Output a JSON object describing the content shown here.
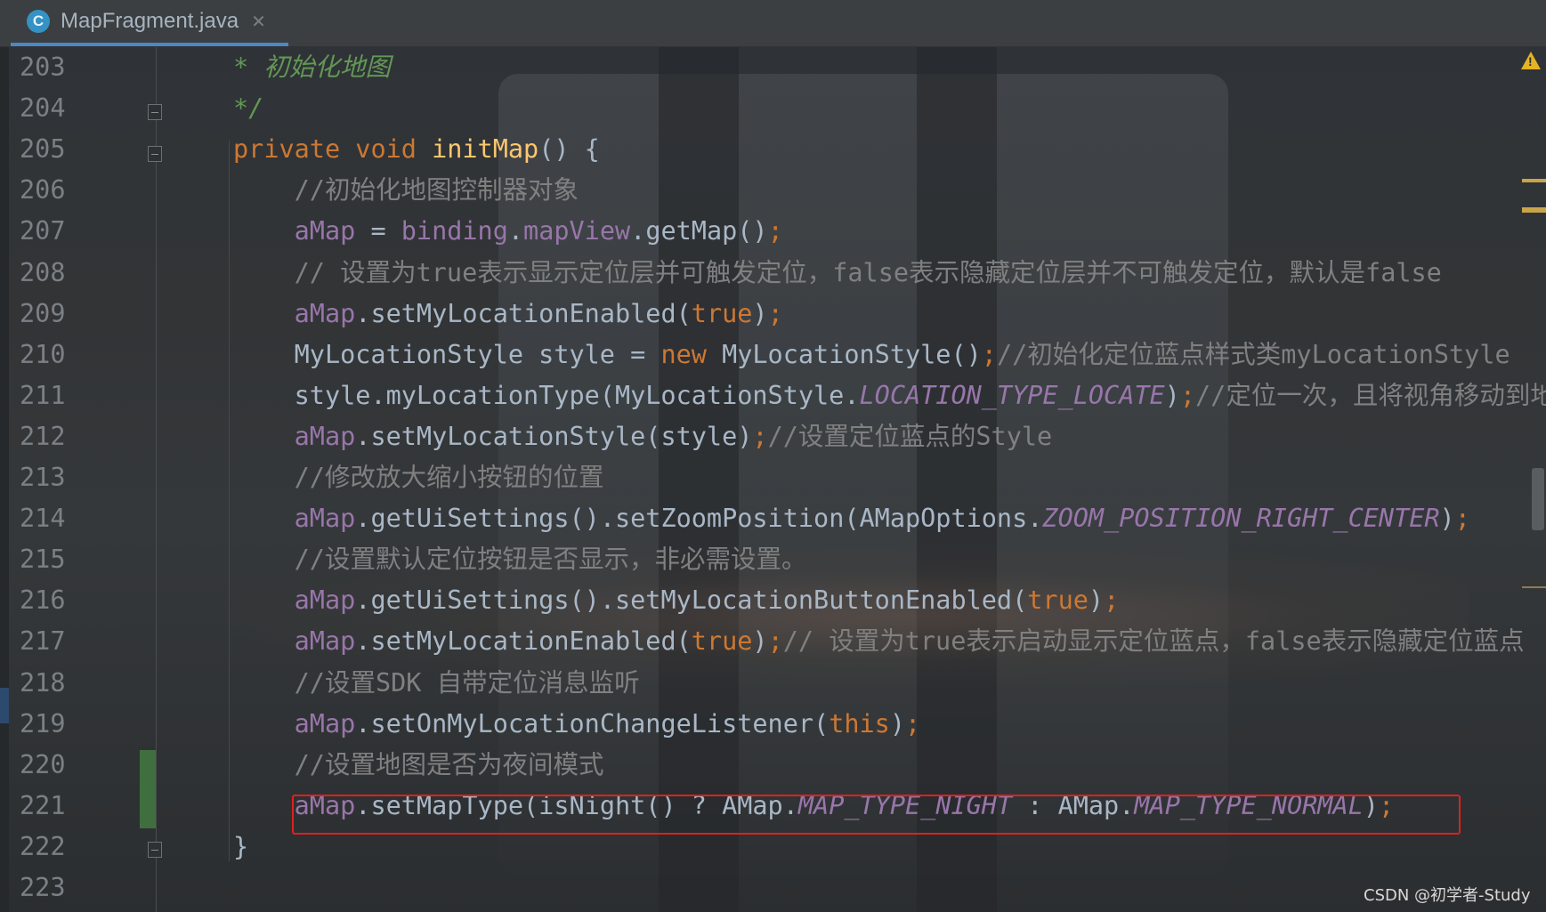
{
  "tab": {
    "icon_letter": "C",
    "filename": "MapFragment.java",
    "close_glyph": "✕"
  },
  "editor": {
    "lines": [
      {
        "num": "203",
        "code": [
          {
            "t": "* ",
            "c": "doc"
          },
          {
            "t": "初始化地图",
            "c": "doc"
          }
        ]
      },
      {
        "num": "204",
        "code": [
          {
            "t": "*/",
            "c": "doc"
          }
        ]
      },
      {
        "num": "205",
        "code": [
          {
            "t": "private ",
            "c": "kw"
          },
          {
            "t": "void ",
            "c": "kw"
          },
          {
            "t": "initMap",
            "c": "fn"
          },
          {
            "t": "() {",
            "c": "pl"
          }
        ]
      },
      {
        "num": "206",
        "code": [
          {
            "t": "    //初始化地图控制器对象",
            "c": "cmt"
          }
        ]
      },
      {
        "num": "207",
        "code": [
          {
            "t": "    ",
            "c": "pl"
          },
          {
            "t": "aMap",
            "c": "fld"
          },
          {
            "t": " = ",
            "c": "pl"
          },
          {
            "t": "binding",
            "c": "fld"
          },
          {
            "t": ".",
            "c": "pl"
          },
          {
            "t": "mapView",
            "c": "fld"
          },
          {
            "t": ".getMap()",
            "c": "pl"
          },
          {
            "t": ";",
            "c": "semi"
          }
        ]
      },
      {
        "num": "208",
        "code": [
          {
            "t": "    // 设置为true表示显示定位层并可触发定位，false表示隐藏定位层并不可触发定位，默认是false",
            "c": "cmt"
          }
        ]
      },
      {
        "num": "209",
        "code": [
          {
            "t": "    ",
            "c": "pl"
          },
          {
            "t": "aMap",
            "c": "fld"
          },
          {
            "t": ".setMyLocationEnabled(",
            "c": "pl"
          },
          {
            "t": "true",
            "c": "kw"
          },
          {
            "t": ")",
            "c": "pl"
          },
          {
            "t": ";",
            "c": "semi"
          }
        ]
      },
      {
        "num": "210",
        "code": [
          {
            "t": "    MyLocationStyle style = ",
            "c": "pl"
          },
          {
            "t": "new ",
            "c": "kw"
          },
          {
            "t": "MyLocationStyle()",
            "c": "pl"
          },
          {
            "t": ";",
            "c": "semi"
          },
          {
            "t": "//初始化定位蓝点样式类myLocationStyle",
            "c": "cmt"
          }
        ]
      },
      {
        "num": "211",
        "code": [
          {
            "t": "    style.myLocationType(MyLocationStyle.",
            "c": "pl"
          },
          {
            "t": "LOCATION_TYPE_LOCATE",
            "c": "fldi"
          },
          {
            "t": ")",
            "c": "pl"
          },
          {
            "t": ";",
            "c": "semi"
          },
          {
            "t": "//定位一次，且将视角移动到地图中心点",
            "c": "cmt"
          }
        ]
      },
      {
        "num": "212",
        "code": [
          {
            "t": "    ",
            "c": "pl"
          },
          {
            "t": "aMap",
            "c": "fld"
          },
          {
            "t": ".setMyLocationStyle(style)",
            "c": "pl"
          },
          {
            "t": ";",
            "c": "semi"
          },
          {
            "t": "//设置定位蓝点的Style",
            "c": "cmt"
          }
        ]
      },
      {
        "num": "213",
        "code": [
          {
            "t": "    //修改放大缩小按钮的位置",
            "c": "cmt"
          }
        ]
      },
      {
        "num": "214",
        "code": [
          {
            "t": "    ",
            "c": "pl"
          },
          {
            "t": "aMap",
            "c": "fld"
          },
          {
            "t": ".getUiSettings().setZoomPosition(AMapOptions.",
            "c": "pl"
          },
          {
            "t": "ZOOM_POSITION_RIGHT_CENTER",
            "c": "fldi"
          },
          {
            "t": ")",
            "c": "pl"
          },
          {
            "t": ";",
            "c": "semi"
          }
        ]
      },
      {
        "num": "215",
        "code": [
          {
            "t": "    //设置默认定位按钮是否显示，非必需设置。",
            "c": "cmt"
          }
        ]
      },
      {
        "num": "216",
        "code": [
          {
            "t": "    ",
            "c": "pl"
          },
          {
            "t": "aMap",
            "c": "fld"
          },
          {
            "t": ".getUiSettings().setMyLocationButtonEnabled(",
            "c": "pl"
          },
          {
            "t": "true",
            "c": "kw"
          },
          {
            "t": ")",
            "c": "pl"
          },
          {
            "t": ";",
            "c": "semi"
          }
        ]
      },
      {
        "num": "217",
        "code": [
          {
            "t": "    ",
            "c": "pl"
          },
          {
            "t": "aMap",
            "c": "fld"
          },
          {
            "t": ".setMyLocationEnabled(",
            "c": "pl"
          },
          {
            "t": "true",
            "c": "kw"
          },
          {
            "t": ")",
            "c": "pl"
          },
          {
            "t": ";",
            "c": "semi"
          },
          {
            "t": "// 设置为true表示启动显示定位蓝点，false表示隐藏定位蓝点",
            "c": "cmt"
          }
        ]
      },
      {
        "num": "218",
        "code": [
          {
            "t": "    //设置SDK 自带定位消息监听",
            "c": "cmt"
          }
        ]
      },
      {
        "num": "219",
        "code": [
          {
            "t": "    ",
            "c": "pl"
          },
          {
            "t": "aMap",
            "c": "fld"
          },
          {
            "t": ".setOnMyLocationChangeListener(",
            "c": "pl"
          },
          {
            "t": "this",
            "c": "kw"
          },
          {
            "t": ")",
            "c": "pl"
          },
          {
            "t": ";",
            "c": "semi"
          }
        ]
      },
      {
        "num": "220",
        "code": [
          {
            "t": "    //设置地图是否为夜间模式",
            "c": "cmt"
          }
        ]
      },
      {
        "num": "221",
        "code": [
          {
            "t": "    ",
            "c": "pl"
          },
          {
            "t": "aMap",
            "c": "fld"
          },
          {
            "t": ".setMapType(isNight() ? AMap.",
            "c": "pl"
          },
          {
            "t": "MAP_TYPE_NIGHT",
            "c": "fldi"
          },
          {
            "t": " : AMap.",
            "c": "pl"
          },
          {
            "t": "MAP_TYPE_NORMAL",
            "c": "fldi"
          },
          {
            "t": ")",
            "c": "pl"
          },
          {
            "t": ";",
            "c": "semi"
          }
        ]
      },
      {
        "num": "222",
        "code": [
          {
            "t": "}",
            "c": "pl"
          }
        ]
      },
      {
        "num": "223",
        "code": []
      }
    ]
  },
  "status": {
    "warning_glyph": "!"
  },
  "watermark": "CSDN @初学者-Study",
  "colors": {
    "keyword": "#cc7832",
    "field": "#9876aa",
    "comment": "#808080",
    "doc_comment": "#629755",
    "plain": "#a9b7c6",
    "function": "#ffc66d",
    "highlight_border": "#e0201c",
    "tab_underline": "#4a88c7"
  }
}
